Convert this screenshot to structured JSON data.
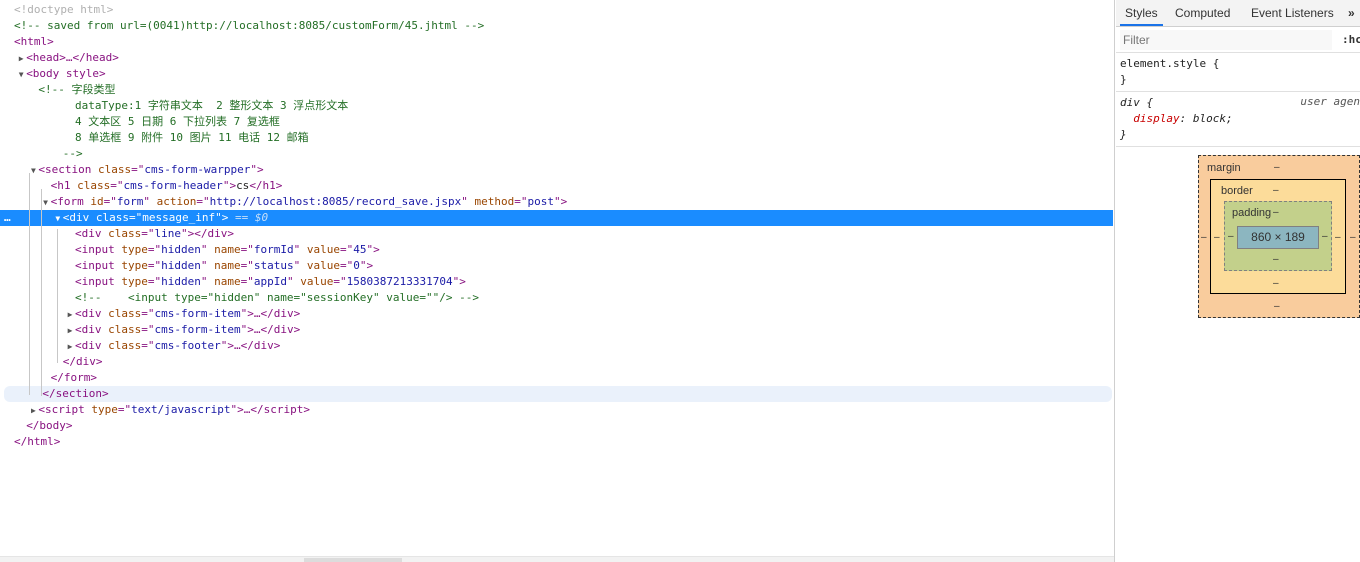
{
  "elements": {
    "doctype": "<!doctype html>",
    "saved_comment": "<!-- saved from url=(0041)http://localhost:8085/customForm/45.jhtml -->",
    "html_open": "<html>",
    "head_collapsed": "<head>…</head>",
    "body_tag": "<body style>",
    "comment_lines": [
      "<!-- 字段类型",
      "dataType:1 字符串文本  2 整形文本 3 浮点形文本",
      "4 文本区 5 日期 6 下拉列表 7 复选框",
      "8 单选框 9 附件 10 图片 11 电话 12 邮箱",
      "-->"
    ],
    "section": {
      "tag": "section",
      "attr": "class",
      "val": "cms-form-warpper"
    },
    "h1": {
      "tag": "h1",
      "attr": "class",
      "val": "cms-form-header",
      "text": "cs"
    },
    "form": {
      "tag": "form",
      "attrs": [
        [
          "id",
          "form"
        ],
        [
          "action",
          "http://localhost:8085/record_save.jspx"
        ],
        [
          "method",
          "post"
        ]
      ]
    },
    "selected": {
      "tag": "div",
      "attr": "class",
      "val": "message_inf",
      "suffix": " == $0",
      "dots": "…"
    },
    "children": [
      {
        "kind": "empty",
        "tag": "div",
        "attrs": [
          [
            "class",
            "line"
          ]
        ]
      },
      {
        "kind": "void",
        "tag": "input",
        "attrs": [
          [
            "type",
            "hidden"
          ],
          [
            "name",
            "formId"
          ],
          [
            "value",
            "45"
          ]
        ]
      },
      {
        "kind": "void",
        "tag": "input",
        "attrs": [
          [
            "type",
            "hidden"
          ],
          [
            "name",
            "status"
          ],
          [
            "value",
            "0"
          ]
        ]
      },
      {
        "kind": "void",
        "tag": "input",
        "attrs": [
          [
            "type",
            "hidden"
          ],
          [
            "name",
            "appId"
          ],
          [
            "value",
            "1580387213331704"
          ]
        ]
      },
      {
        "kind": "comment",
        "text": "<!--    <input type=\"hidden\" name=\"sessionKey\" value=\"\"/> -->"
      },
      {
        "kind": "collapsed",
        "tag": "div",
        "attrs": [
          [
            "class",
            "cms-form-item"
          ]
        ]
      },
      {
        "kind": "collapsed",
        "tag": "div",
        "attrs": [
          [
            "class",
            "cms-form-item"
          ]
        ]
      },
      {
        "kind": "collapsed",
        "tag": "div",
        "attrs": [
          [
            "class",
            "cms-footer"
          ]
        ]
      }
    ],
    "div_close": "</div>",
    "form_close": "</form>",
    "section_close": "</section>",
    "script": {
      "tag": "script",
      "attr": "type",
      "val": "text/javascript"
    },
    "body_close": "</body>",
    "html_close": "</html>"
  },
  "sidebar": {
    "tabs": [
      "Styles",
      "Computed",
      "Event Listeners",
      "»"
    ],
    "filter_placeholder": "Filter",
    "hov_label": ":hc",
    "element_style": {
      "selector": "element.style {",
      "close": "}"
    },
    "div_rule": {
      "selector": "div {",
      "source": "user agen",
      "prop": "display",
      "value": "block;",
      "close": "}"
    },
    "box_model": {
      "margin_label": "margin",
      "border_label": "border",
      "padding_label": "padding",
      "content_size": "860 × 189",
      "dash": "–"
    }
  },
  "colors": {
    "selection": "#1a8cff",
    "tag": "#881280",
    "attr": "#994500",
    "value": "#1a1aa6",
    "comment": "#236e25"
  }
}
